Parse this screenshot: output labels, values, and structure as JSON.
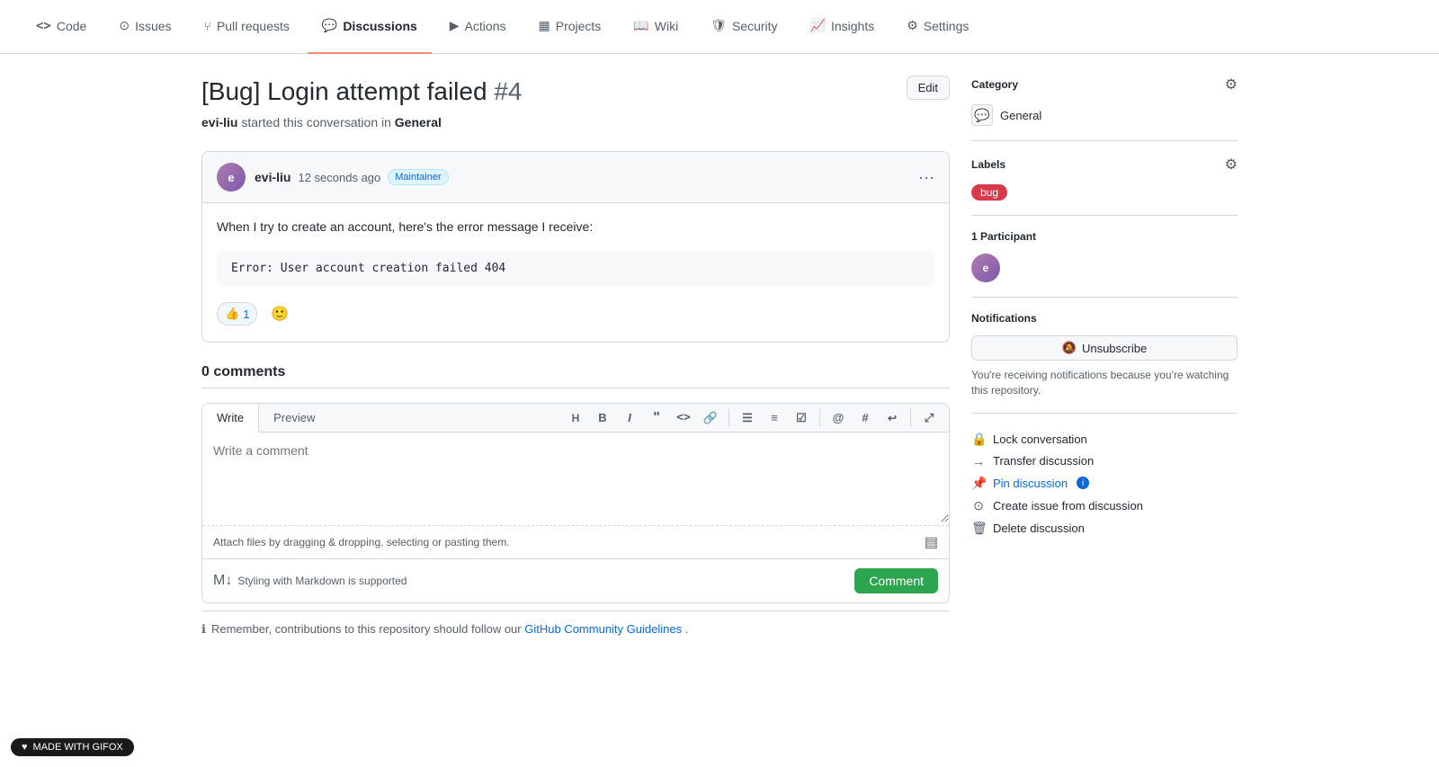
{
  "nav": {
    "items": [
      {
        "id": "code",
        "label": "Code",
        "icon": "<>",
        "active": false
      },
      {
        "id": "issues",
        "label": "Issues",
        "icon": "○",
        "active": false
      },
      {
        "id": "pull-requests",
        "label": "Pull requests",
        "icon": "⑂",
        "active": false
      },
      {
        "id": "discussions",
        "label": "Discussions",
        "icon": "💬",
        "active": true
      },
      {
        "id": "actions",
        "label": "Actions",
        "icon": "▶",
        "active": false
      },
      {
        "id": "projects",
        "label": "Projects",
        "icon": "▦",
        "active": false
      },
      {
        "id": "wiki",
        "label": "Wiki",
        "icon": "📖",
        "active": false
      },
      {
        "id": "security",
        "label": "Security",
        "icon": "🛡",
        "active": false
      },
      {
        "id": "insights",
        "label": "Insights",
        "icon": "📈",
        "active": false
      },
      {
        "id": "settings",
        "label": "Settings",
        "icon": "⚙",
        "active": false
      }
    ]
  },
  "page": {
    "title": "[Bug] Login attempt failed",
    "issue_number": "#4",
    "edit_button": "Edit",
    "subtitle_author": "evi-liu",
    "subtitle_text": " started this conversation in ",
    "subtitle_category": "General"
  },
  "discussion": {
    "author": "evi-liu",
    "timestamp": "12 seconds ago",
    "badge": "Maintainer",
    "body": "When I try to create an account, here's the error message I receive:",
    "code": "Error: User account creation failed 404",
    "reaction_emoji": "👍",
    "reaction_count": "1",
    "emoji_add": "😊"
  },
  "comments": {
    "count_label": "0 comments"
  },
  "comment_box": {
    "write_tab": "Write",
    "preview_tab": "Preview",
    "placeholder": "Write a comment",
    "attach_text": "Attach files by dragging & dropping, selecting or pasting them.",
    "markdown_label": "Styling with Markdown is supported",
    "submit_label": "Comment",
    "info_text": "Remember, contributions to this repository should follow our ",
    "info_link": "GitHub Community Guidelines",
    "info_end": "."
  },
  "sidebar": {
    "category_title": "Category",
    "category_name": "General",
    "labels_title": "Labels",
    "label_bug": "bug",
    "participants_title": "1 participant",
    "notifications_title": "Notifications",
    "unsubscribe_label": "Unsubscribe",
    "notification_body": "You're receiving notifications because you're watching this repository.",
    "actions": {
      "lock": "Lock conversation",
      "transfer": "Transfer discussion",
      "pin": "Pin discussion",
      "create_issue": "Create issue from discussion",
      "delete": "Delete discussion"
    }
  },
  "gifox": {
    "label": "MADE WITH GIFOX"
  }
}
